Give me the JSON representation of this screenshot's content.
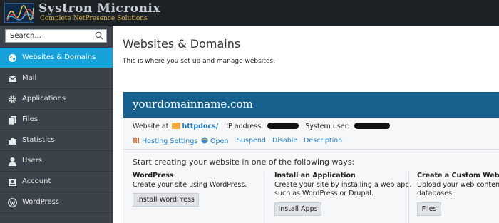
{
  "brand": {
    "title": "Systron Micronix",
    "subtitle": "Complete NetPresence Solutions"
  },
  "sidebar": {
    "search_placeholder": "Search...",
    "items": [
      {
        "label": "Websites & Domains",
        "icon": "globe-icon",
        "active": true
      },
      {
        "label": "Mail",
        "icon": "envelope-icon",
        "active": false
      },
      {
        "label": "Applications",
        "icon": "gear-icon",
        "active": false
      },
      {
        "label": "Files",
        "icon": "files-icon",
        "active": false
      },
      {
        "label": "Statistics",
        "icon": "bar-chart-icon",
        "active": false
      },
      {
        "label": "Users",
        "icon": "user-icon",
        "active": false
      },
      {
        "label": "Account",
        "icon": "id-card-icon",
        "active": false
      },
      {
        "label": "WordPress",
        "icon": "wordpress-icon",
        "active": false
      }
    ]
  },
  "main": {
    "title": "Websites & Domains",
    "description": "This is where you set up and manage websites."
  },
  "domain": {
    "name": "yourdomainname.com",
    "website_at_label": "Website at",
    "docroot": "httpdocs/",
    "ip_label": "IP address:",
    "system_user_label": "System user:",
    "actions": [
      "Hosting Settings",
      "Open",
      "Suspend",
      "Disable",
      "Description"
    ],
    "start_text": "Start creating your website in one of the following ways:",
    "options": [
      {
        "title": "WordPress",
        "desc1": "Create your site using WordPress.",
        "desc2": "",
        "button": "Install WordPress"
      },
      {
        "title": "Install an Application",
        "desc1": "Create your site by installing a web app,",
        "desc2": "such as WordPress or Drupal.",
        "button": "Install Apps"
      },
      {
        "title": "Create a Custom Website",
        "desc1": "Upload your web content a",
        "desc2": "databases.",
        "button": "Files"
      }
    ]
  },
  "colors": {
    "topbar": "#1d2226",
    "sidebar": "#3b4249",
    "active": "#17a2dc",
    "domain_header": "#17618f",
    "link": "#1c7bc2"
  }
}
